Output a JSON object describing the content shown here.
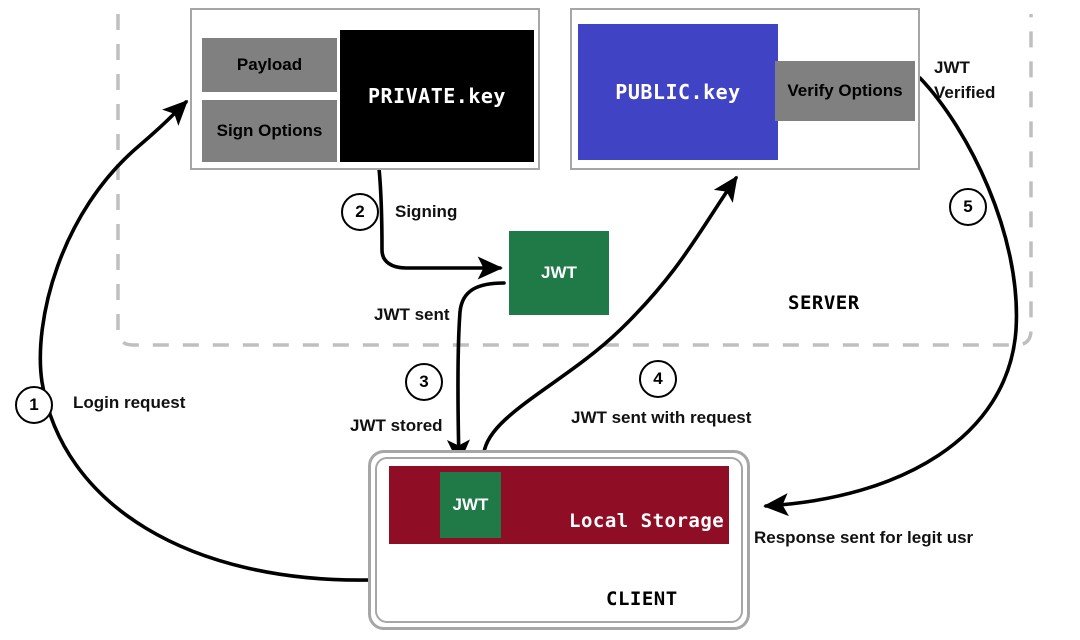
{
  "diagram": {
    "title": "JWT asymmetric signing and verification flow",
    "colors": {
      "server_boundary": "#bfbfbf",
      "panel_border": "#a6a6a6",
      "grey_chip": "#808080",
      "private_key": "#000000",
      "public_key": "#4043c4",
      "jwt_green": "#1f7a47",
      "local_storage_red": "#8f0d25",
      "arrow": "#000000"
    }
  },
  "server": {
    "label": "SERVER",
    "signing_box": {
      "payload_label": "Payload",
      "sign_options_label": "Sign Options",
      "private_key_label": "PRIVATE.key"
    },
    "verify_box": {
      "public_key_label": "PUBLIC.key",
      "verify_options_label": "Verify Options"
    },
    "jwt_token_label": "JWT"
  },
  "client": {
    "label": "CLIENT",
    "local_storage_label": "Local Storage",
    "jwt_token_label": "JWT"
  },
  "steps": [
    {
      "number": "1",
      "label": "Login request"
    },
    {
      "number": "2",
      "label": "Signing"
    },
    {
      "number": "3",
      "label": "JWT stored"
    },
    {
      "number": "4",
      "label": "JWT sent with request"
    },
    {
      "number": "5",
      "label": "JWT\nVerified"
    }
  ],
  "annotations": {
    "step1": "Login request",
    "step2": "Signing",
    "step3": "JWT stored",
    "step4": "JWT sent with request",
    "jwt_sent": "JWT sent",
    "jwt_verified_line1": "JWT",
    "jwt_verified_line2": "Verified",
    "response": "Response sent for legit usr"
  }
}
